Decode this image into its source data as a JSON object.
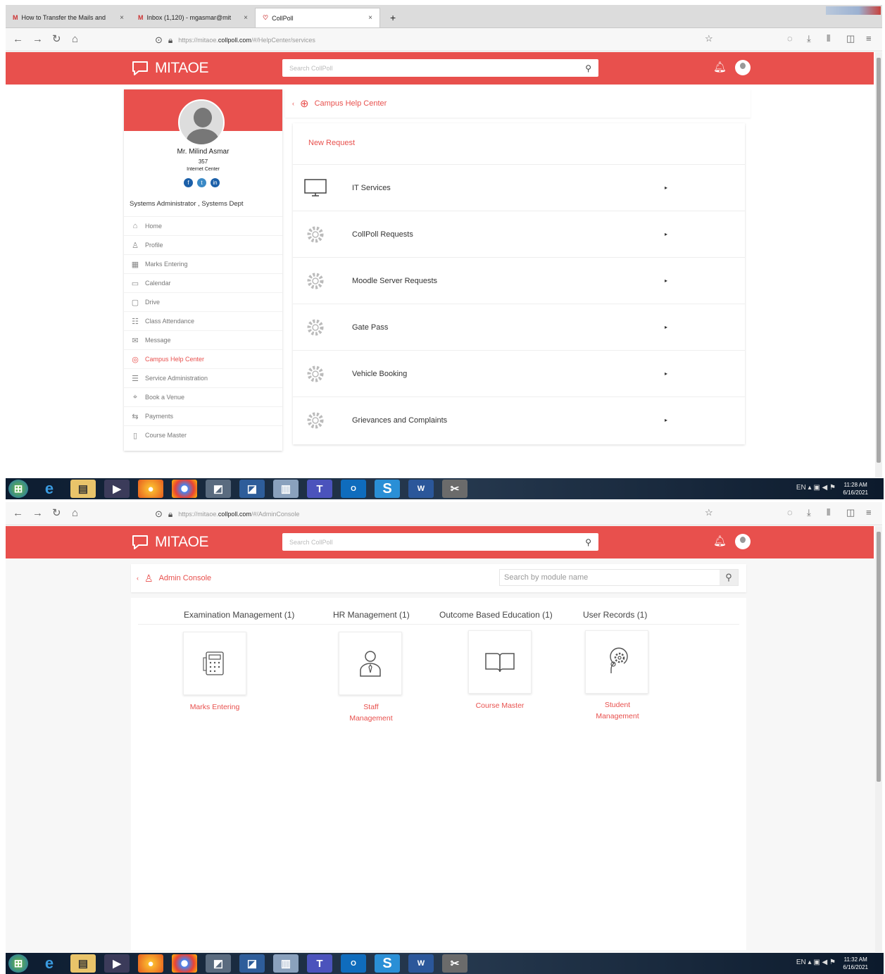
{
  "browser": {
    "tabs": [
      {
        "label": "How to Transfer the Mails and"
      },
      {
        "label": "Inbox (1,120) - mgasmar@mit"
      },
      {
        "label": "CollPoll"
      }
    ],
    "screen1_url": {
      "prefix": "https://mitaoe.",
      "host": "collpoll.com",
      "path": "/#/HelpCenter/services"
    },
    "screen2_url": {
      "prefix": "https://mitaoe.",
      "host": "collpoll.com",
      "path": "/#/AdminConsole"
    }
  },
  "app": {
    "brand": "MITAOE",
    "search_placeholder": "Search CollPoll",
    "brand_color": "#e8504d"
  },
  "profile": {
    "name": "Mr. Milind Asmar",
    "id": "357",
    "dept_short": "Internet Center",
    "role": "Systems Administrator , Systems Dept"
  },
  "sidebar": {
    "items": [
      {
        "label": "Home",
        "icon": "home-icon"
      },
      {
        "label": "Profile",
        "icon": "user-icon"
      },
      {
        "label": "Marks Entering",
        "icon": "marks-icon"
      },
      {
        "label": "Calendar",
        "icon": "calendar-icon"
      },
      {
        "label": "Drive",
        "icon": "folder-icon"
      },
      {
        "label": "Class Attendance",
        "icon": "attendance-icon"
      },
      {
        "label": "Message",
        "icon": "message-icon"
      },
      {
        "label": "Campus Help Center",
        "icon": "help-icon"
      },
      {
        "label": "Service Administration",
        "icon": "service-icon"
      },
      {
        "label": "Book a Venue",
        "icon": "location-icon"
      },
      {
        "label": "Payments",
        "icon": "payment-icon"
      },
      {
        "label": "Course Master",
        "icon": "book-icon"
      }
    ]
  },
  "help_center": {
    "breadcrumb": "Campus Help Center",
    "new_request": "New Request",
    "services": [
      {
        "label": "IT Services"
      },
      {
        "label": "CollPoll Requests"
      },
      {
        "label": "Moodle Server Requests"
      },
      {
        "label": "Gate Pass"
      },
      {
        "label": "Vehicle Booking"
      },
      {
        "label": "Grievances and Complaints"
      }
    ]
  },
  "admin_console": {
    "breadcrumb": "Admin Console",
    "search_placeholder": "Search by module name",
    "categories": [
      {
        "label": "Examination Management (1)"
      },
      {
        "label": "HR Management (1)"
      },
      {
        "label": "Outcome Based Education (1)"
      },
      {
        "label": "User Records (1)"
      }
    ],
    "modules": [
      {
        "line1": "Marks Entering",
        "line2": ""
      },
      {
        "line1": "Staff",
        "line2": "Management"
      },
      {
        "line1": "Course Master",
        "line2": ""
      },
      {
        "line1": "Student",
        "line2": "Management"
      }
    ]
  },
  "taskbar": {
    "lang": "EN",
    "screen1_time": "11:28 AM",
    "screen1_date": "6/16/2021",
    "screen2_time": "11:32 AM",
    "screen2_date": "6/16/2021"
  }
}
